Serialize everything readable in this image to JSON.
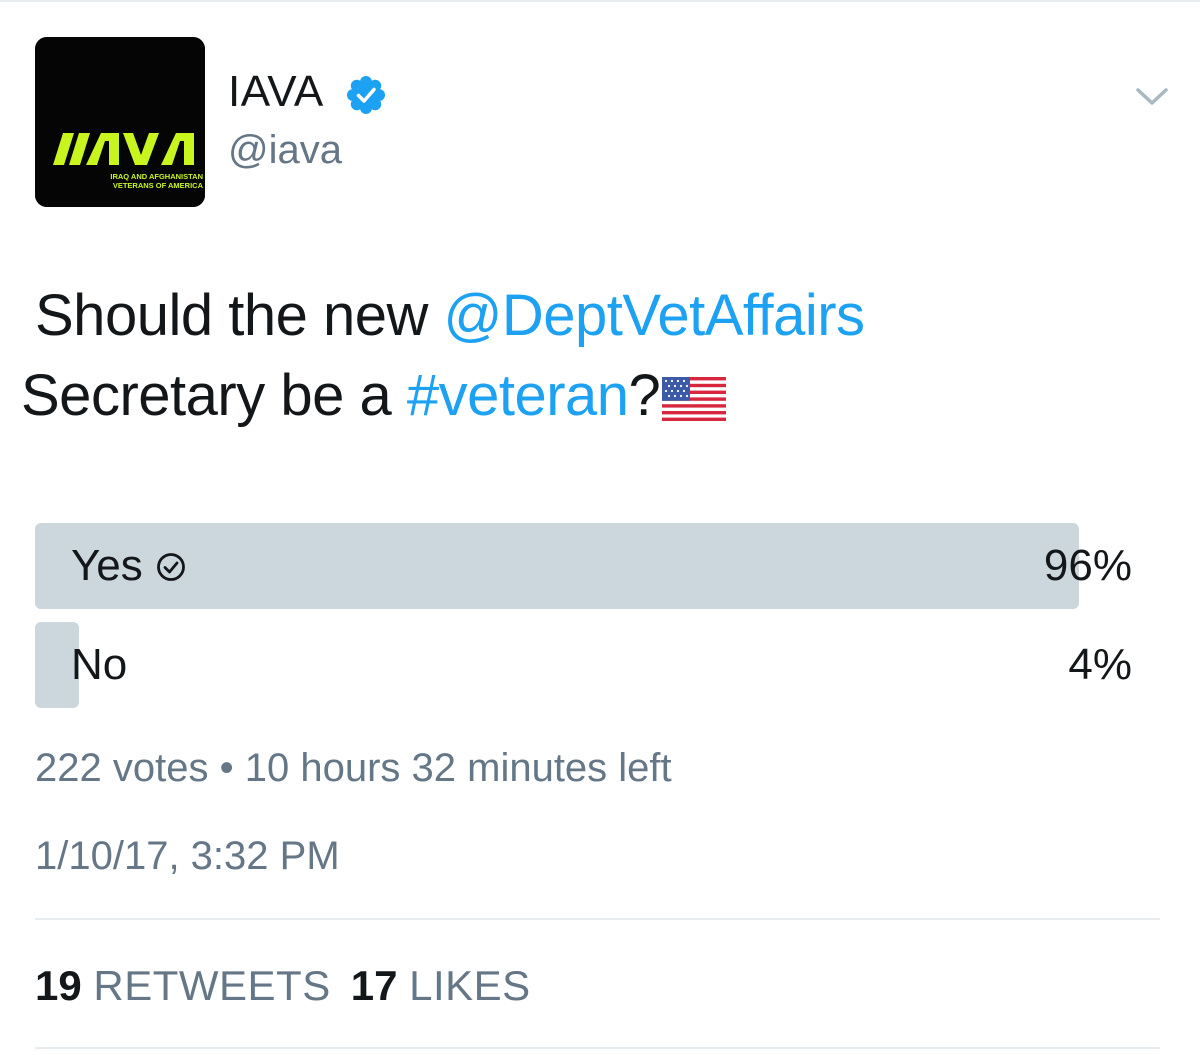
{
  "user": {
    "display_name": "IAVA",
    "handle": "@iava",
    "verified": true,
    "avatar": {
      "logo_text": "IAVA",
      "logo_subtext_line1": "IRAQ AND AFGHANISTAN",
      "logo_subtext_line2": "VETERANS OF AMERICA",
      "logo_color": "#c8f51f",
      "background_color": "#050505"
    }
  },
  "tweet": {
    "text_part1": "Should the new ",
    "mention": "@DeptVetAffairs",
    "text_part2": " Secretary be a ",
    "hashtag": "#veteran",
    "text_part3": "?",
    "emoji": "us-flag-icon"
  },
  "poll": {
    "options": [
      {
        "label": "Yes",
        "percent": 96,
        "percent_label": "96%",
        "selected": true
      },
      {
        "label": "No",
        "percent": 4,
        "percent_label": "4%",
        "selected": false
      }
    ],
    "votes_label": "222 votes",
    "separator": "•",
    "time_left": "10 hours 32 minutes left"
  },
  "timestamp": "1/10/17, 3:32 PM",
  "stats": {
    "retweets_count": "19",
    "retweets_label": "RETWEETS",
    "likes_count": "17",
    "likes_label": "LIKES"
  },
  "colors": {
    "link": "#1da1f2",
    "secondary_text": "#657786",
    "poll_bar": "#ccd6dd",
    "verified_badge": "#1da1f2",
    "divider": "#e6ecf0"
  },
  "icons": {
    "verified": "verified-badge-icon",
    "menu": "chevron-down-icon",
    "poll_choice": "check-circle-icon"
  }
}
